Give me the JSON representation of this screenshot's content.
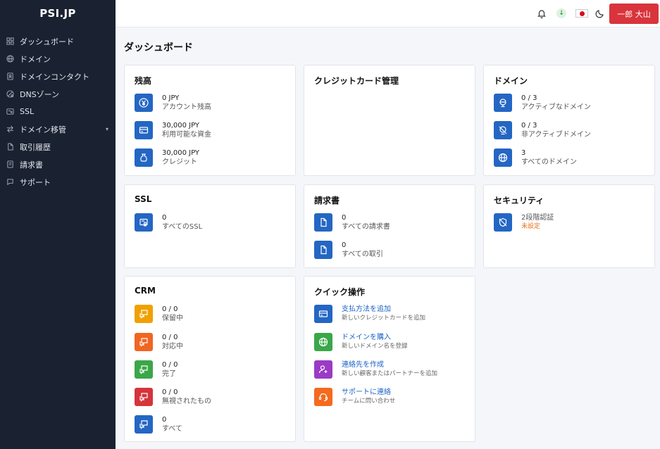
{
  "brand": "PSI.JP",
  "sidebar": {
    "items": [
      {
        "label": "ダッシュボード",
        "icon": "grid-icon"
      },
      {
        "label": "ドメイン",
        "icon": "globe-icon"
      },
      {
        "label": "ドメインコンタクト",
        "icon": "contact-icon"
      },
      {
        "label": "DNSゾーン",
        "icon": "dns-icon"
      },
      {
        "label": "SSL",
        "icon": "certificate-icon"
      },
      {
        "label": "ドメイン移管",
        "icon": "transfer-icon"
      },
      {
        "label": "取引履歴",
        "icon": "document-icon"
      },
      {
        "label": "請求書",
        "icon": "invoice-icon"
      },
      {
        "label": "サポート",
        "icon": "support-icon"
      }
    ]
  },
  "topbar": {
    "user_label": "一郎 大山",
    "download_mark": "↓"
  },
  "page_title": "ダッシュボード",
  "cards": {
    "balance": {
      "title": "残高",
      "rows": [
        {
          "value": "0 JPY",
          "label": "アカウント残高",
          "icon": "yen-icon"
        },
        {
          "value": "30,000 JPY",
          "label": "利用可能な資金",
          "icon": "card-icon"
        },
        {
          "value": "30,000 JPY",
          "label": "クレジット",
          "icon": "money-bag-icon"
        }
      ]
    },
    "credit_card": {
      "title": "クレジットカード管理"
    },
    "domain": {
      "title": "ドメイン",
      "rows": [
        {
          "value": "0 / 3",
          "label": "アクティブなドメイン",
          "icon": "globe-active-icon"
        },
        {
          "value": "0 / 3",
          "label": "非アクティブドメイン",
          "icon": "globe-off-icon"
        },
        {
          "value": "3",
          "label": "すべてのドメイン",
          "icon": "globe-icon"
        }
      ]
    },
    "ssl": {
      "title": "SSL",
      "rows": [
        {
          "value": "0",
          "label": "すべてのSSL",
          "icon": "certificate-icon"
        }
      ]
    },
    "invoice": {
      "title": "請求書",
      "rows": [
        {
          "value": "0",
          "label": "すべての請求書",
          "icon": "document-icon"
        },
        {
          "value": "0",
          "label": "すべての取引",
          "icon": "document-icon"
        }
      ]
    },
    "security": {
      "title": "セキュリティ",
      "rows": [
        {
          "value": "2段階認証",
          "label": "未設定",
          "icon": "shield-off-icon"
        }
      ]
    },
    "crm": {
      "title": "CRM",
      "rows": [
        {
          "value": "0 / 0",
          "label": "保留中",
          "icon": "chat-icon",
          "color": "#f0a100"
        },
        {
          "value": "0 / 0",
          "label": "対応中",
          "icon": "chat-icon",
          "color": "#f16522"
        },
        {
          "value": "0 / 0",
          "label": "完了",
          "icon": "chat-icon",
          "color": "#3aa748"
        },
        {
          "value": "0 / 0",
          "label": "無視されたもの",
          "icon": "chat-icon",
          "color": "#d5343b"
        },
        {
          "value": "0",
          "label": "すべて",
          "icon": "chat-icon",
          "color": "#2466c4"
        }
      ]
    },
    "quick": {
      "title": "クイック操作",
      "rows": [
        {
          "link": "支払方法を追加",
          "sub": "新しいクレジットカードを追加",
          "icon": "card-icon",
          "color": "#2466c4"
        },
        {
          "link": "ドメインを購入",
          "sub": "新しいドメイン名を登録",
          "icon": "globe-icon",
          "color": "#3aa748"
        },
        {
          "link": "連絡先を作成",
          "sub": "新しい顧客またはパートナーを追加",
          "icon": "user-add-icon",
          "color": "#9a3bc6"
        },
        {
          "link": "サポートに連絡",
          "sub": "チームに問い合わせ",
          "icon": "headset-icon",
          "color": "#f46a1f"
        }
      ]
    }
  },
  "colors": {
    "sidebar_bg": "#1a2231",
    "accent_blue": "#2466c4",
    "user_button": "#d9343b",
    "warning": "#e8711c"
  }
}
